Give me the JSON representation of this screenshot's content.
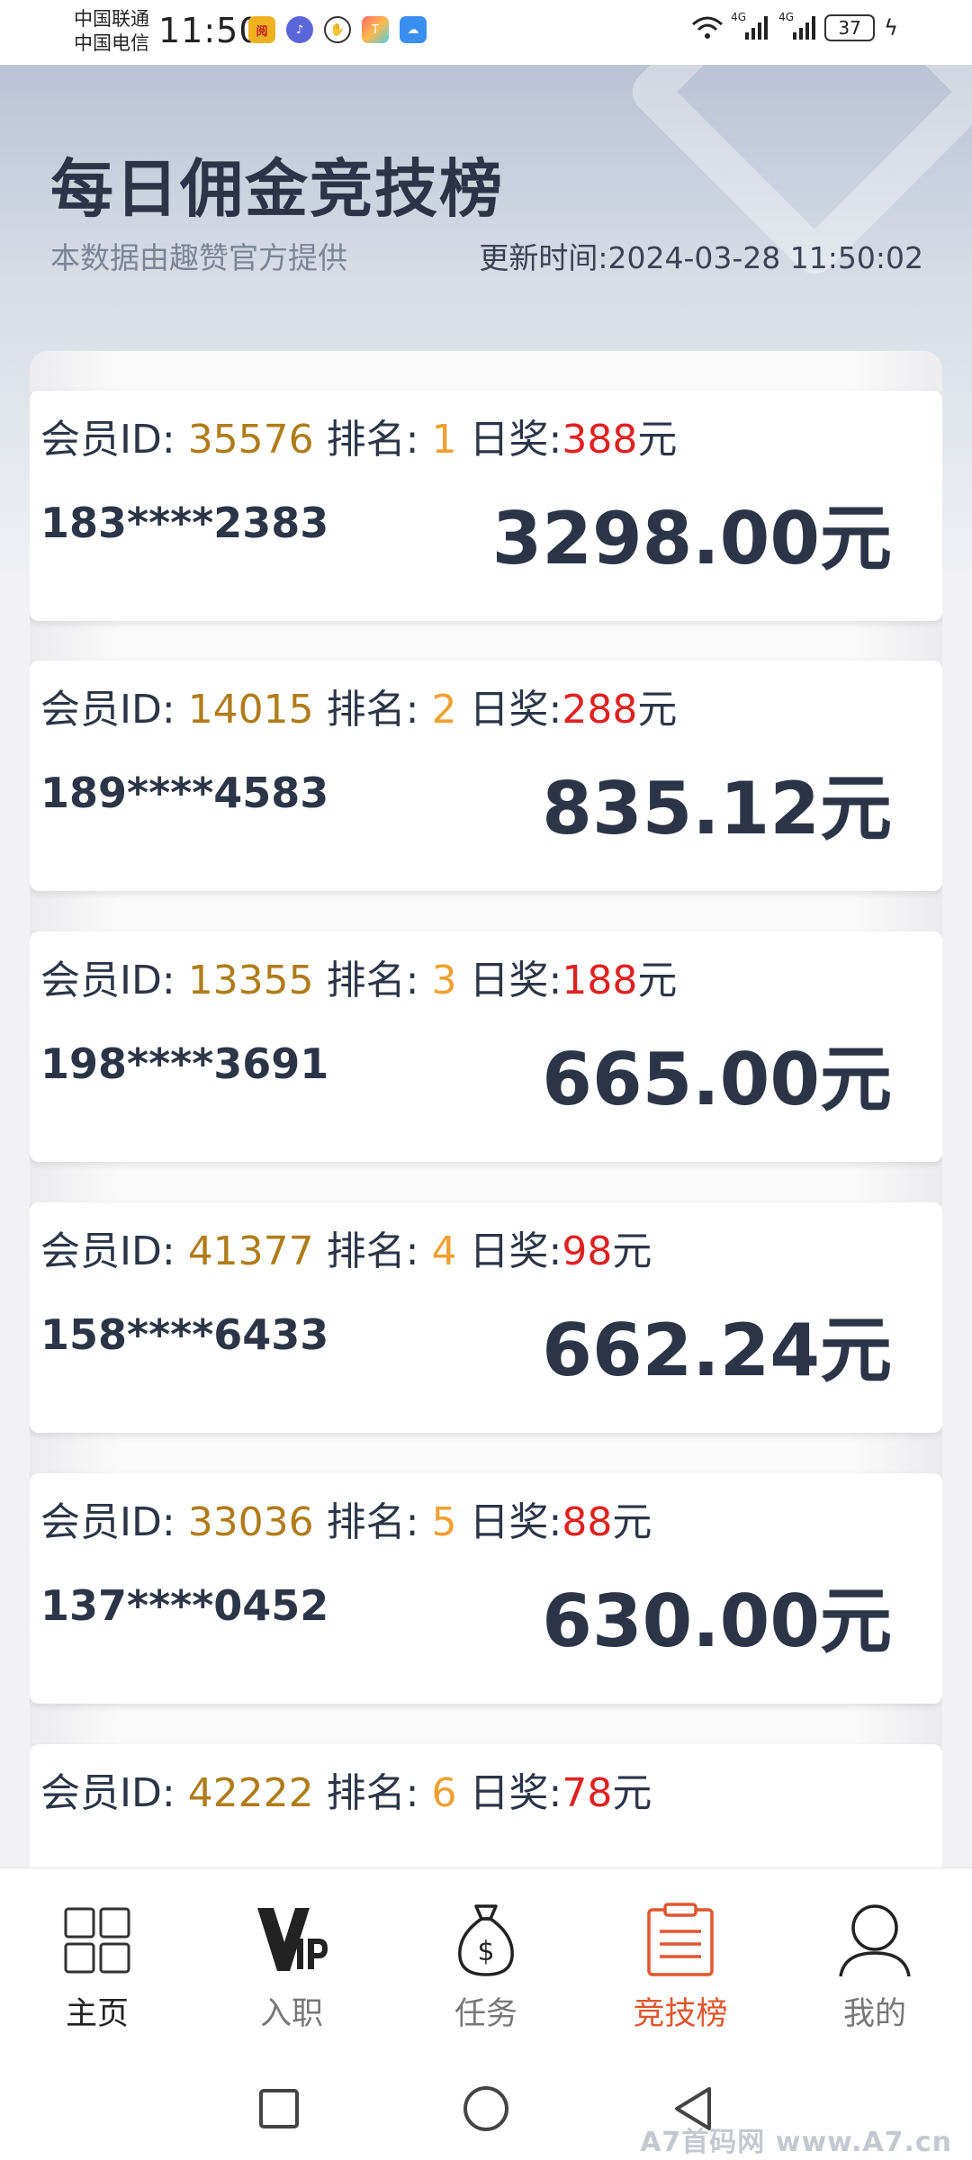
{
  "status_bar": {
    "carrier1": "中国联通",
    "carrier2": "中国电信",
    "time": "11:50",
    "net_tag": "4G",
    "battery": "37"
  },
  "header": {
    "title": "每日佣金竞技榜",
    "subtitle": "本数据由趣赞官方提供",
    "update_time": "更新时间:2024-03-28 11:50:02"
  },
  "labels": {
    "member_id": "会员ID:",
    "rank": "排名:",
    "daily_prize": "日奖:",
    "currency": "元"
  },
  "entries": [
    {
      "member_id": "35576",
      "rank": "1",
      "prize": "388",
      "phone": "183****2383",
      "amount": "3298.00元"
    },
    {
      "member_id": "14015",
      "rank": "2",
      "prize": "288",
      "phone": "189****4583",
      "amount": "835.12元"
    },
    {
      "member_id": "13355",
      "rank": "3",
      "prize": "188",
      "phone": "198****3691",
      "amount": "665.00元"
    },
    {
      "member_id": "41377",
      "rank": "4",
      "prize": "98",
      "phone": "158****6433",
      "amount": "662.24元"
    },
    {
      "member_id": "33036",
      "rank": "5",
      "prize": "88",
      "phone": "137****0452",
      "amount": "630.00元"
    },
    {
      "member_id": "42222",
      "rank": "6",
      "prize": "78",
      "phone": "",
      "amount": ""
    }
  ],
  "nav": {
    "home": "主页",
    "join": "入职",
    "tasks": "任务",
    "leaderboard": "竞技榜",
    "mine": "我的"
  },
  "watermark": "A7首码网   www.A7.cn",
  "colors": {
    "id_color": "#b07c1a",
    "rank_color": "#f0a030",
    "prize_color": "#e02020",
    "active_nav": "#e0562e",
    "text_dark": "#2c3548"
  }
}
